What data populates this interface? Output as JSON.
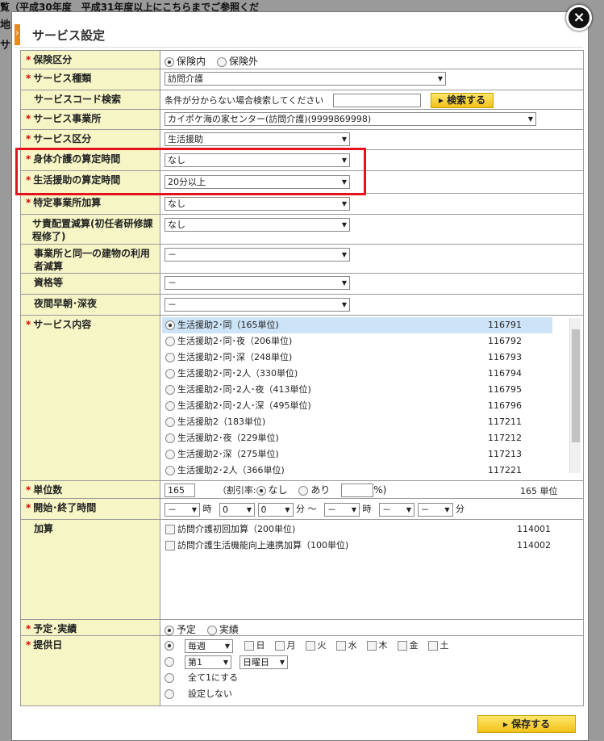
{
  "background": {
    "line1": "覧（平成30年度　平成31年度以上にこちらまでご参照ください",
    "line2": "地",
    "line3": "サ"
  },
  "modal": {
    "title": "サービス設定",
    "close": "×"
  },
  "rows": {
    "hoken": {
      "label": "保険区分",
      "opt1": "保険内",
      "opt2": "保険外"
    },
    "shurui": {
      "label": "サービス種類",
      "value": "訪問介護"
    },
    "code": {
      "label": "サービスコード検索",
      "hint": "条件が分からない場合検索してください",
      "button": "検索する"
    },
    "jigyosho": {
      "label": "サービス事業所",
      "value": "カイポケ海の家センター(訪問介護)(9999869998)"
    },
    "kubun": {
      "label": "サービス区分",
      "value": "生活援助"
    },
    "shintai": {
      "label": "身体介護の算定時間",
      "value": "なし"
    },
    "seikatsu": {
      "label": "生活援助の算定時間",
      "value": "20分以上"
    },
    "tokutei": {
      "label": "特定事業所加算",
      "value": "なし"
    },
    "sasekinin": {
      "label": "サ責配置減算(初任者研修課程修了)",
      "value": "なし"
    },
    "douitsu": {
      "label": "事業所と同一の建物の利用者減算",
      "value": "－"
    },
    "shikaku": {
      "label": "資格等",
      "value": "－"
    },
    "yakan": {
      "label": "夜間早朝･深夜",
      "value": "－"
    },
    "naiyou": {
      "label": "サービス内容",
      "items": [
        {
          "name": "生活援助2･同（165単位)",
          "code": "116791"
        },
        {
          "name": "生活援助2･同･夜（206単位)",
          "code": "116792"
        },
        {
          "name": "生活援助2･同･深（248単位)",
          "code": "116793"
        },
        {
          "name": "生活援助2･同･2人（330単位)",
          "code": "116794"
        },
        {
          "name": "生活援助2･同･2人･夜（413単位)",
          "code": "116795"
        },
        {
          "name": "生活援助2･同･2人･深（495単位)",
          "code": "116796"
        },
        {
          "name": "生活援助2（183単位)",
          "code": "117211"
        },
        {
          "name": "生活援助2･夜（229単位)",
          "code": "117212"
        },
        {
          "name": "生活援助2･深（275単位)",
          "code": "117213"
        },
        {
          "name": "生活援助2･2人（366単位)",
          "code": "117221"
        }
      ]
    },
    "tanisu": {
      "label": "単位数",
      "value": "165",
      "waribiki": "（割引率:",
      "nashi": "なし",
      "ari": "あり",
      "pct": "%)",
      "units": "165 単位"
    },
    "jikan": {
      "label": "開始･終了時間",
      "dash": "－",
      "zero": "0",
      "ji": "時",
      "fun": "分",
      "tilde": "～"
    },
    "kasan": {
      "label": "加算",
      "items": [
        {
          "name": "訪問介護初回加算（200単位)",
          "code": "114001"
        },
        {
          "name": "訪問介護生活機能向上連携加算（100単位)",
          "code": "114002"
        }
      ]
    },
    "yotei": {
      "label": "予定･実績",
      "opt1": "予定",
      "opt2": "実績"
    },
    "teikyo": {
      "label": "提供日",
      "weekly": "毎週",
      "days": [
        "日",
        "月",
        "火",
        "水",
        "木",
        "金",
        "土"
      ],
      "first": "第1",
      "weekday": "日曜日",
      "all1": "全て1にする",
      "none": "設定しない"
    }
  },
  "save": "保存する"
}
